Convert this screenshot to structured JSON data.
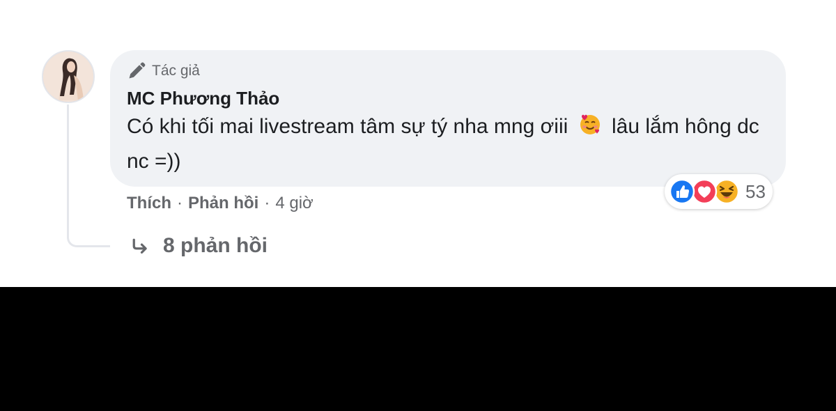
{
  "comment": {
    "author_badge": "Tác giả",
    "author_badge_icon": "pencil-icon",
    "author_name": "MC Phương Thảo",
    "text_before_emoji": "Có khi tối mai livestream tâm sự tý nha mng ơiii",
    "emoji": "smiling-face-with-hearts",
    "text_after_emoji": "lâu lắm hông dc nc =))",
    "reactions": {
      "icons": [
        "like-icon",
        "love-icon",
        "haha-icon"
      ],
      "count": "53"
    },
    "actions": {
      "like_label": "Thích",
      "reply_label": "Phản hồi",
      "separator": "·",
      "time": "4 giờ"
    },
    "replies": {
      "icon": "reply-arrow-icon",
      "label": "8 phản hồi"
    }
  },
  "colors": {
    "bubble_bg": "#f0f2f5",
    "text_primary": "#1c1e21",
    "text_secondary": "#65676b",
    "like_blue": "#1877f2",
    "love_red": "#f33e58",
    "haha_yellow": "#f7b125",
    "bottom_bar": "#000000"
  }
}
